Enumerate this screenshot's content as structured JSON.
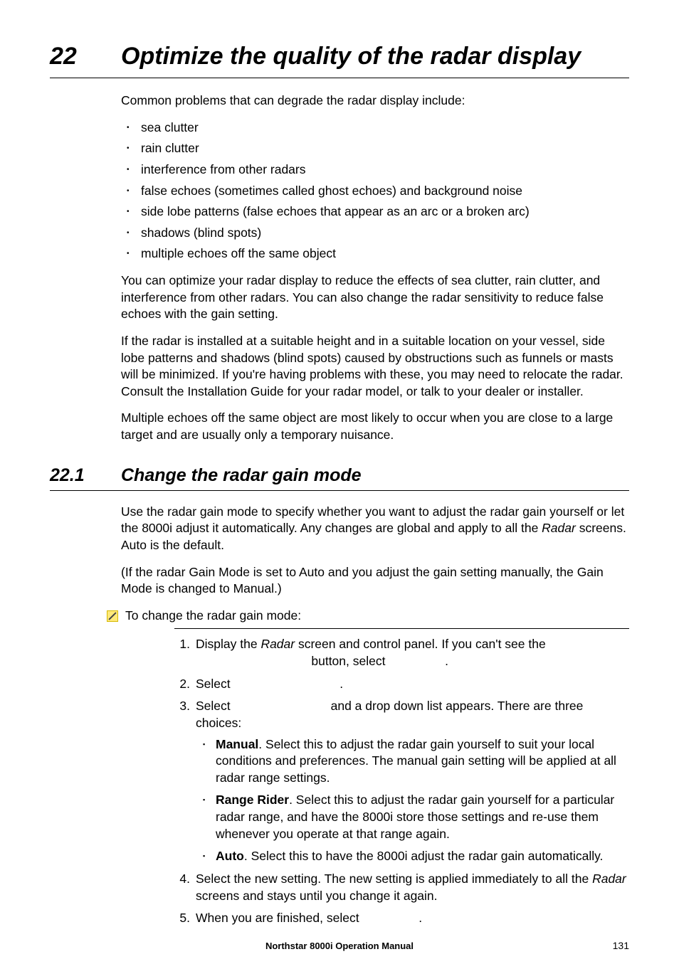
{
  "chapter": {
    "number": "22",
    "title": "Optimize the quality of the radar display"
  },
  "intro_para": "Common problems that can degrade the radar display include:",
  "problems": [
    "sea clutter",
    "rain clutter",
    "interference from other radars",
    "false echoes (sometimes called ghost echoes) and background noise",
    "side lobe patterns (false echoes that appear as an arc or a broken arc)",
    "shadows (blind spots)",
    "multiple echoes off the same object"
  ],
  "para2": "You can optimize your radar display to reduce the effects of sea clutter, rain clutter, and interference from other radars. You can also change the radar sensitivity to reduce false echoes with the gain setting.",
  "para3": "If the radar is installed at a suitable height and in a suitable location on your vessel, side lobe patterns and shadows (blind spots) caused by obstructions such as funnels or masts will be minimized. If you're having problems with these, you may need to relocate the radar. Consult the Installation Guide for your radar model, or talk to your dealer or installer.",
  "para4": "Multiple echoes off the same object are most likely to occur when you are close to a large target and are usually only a temporary nuisance.",
  "section": {
    "number": "22.1",
    "title": "Change the radar gain mode"
  },
  "section_para1_a": "Use the radar gain mode to specify whether you want to adjust the radar gain yourself or let the 8000i adjust it automatically. Any changes are global and apply to all the ",
  "section_para1_italic": "Radar",
  "section_para1_b": " screens. Auto is the default.",
  "section_para2": "(If the radar Gain Mode is set to Auto and you adjust the gain setting manually, the Gain Mode is changed to Manual.)",
  "procedure_label": "To change the radar gain mode:",
  "steps": {
    "s1_a": "Display the ",
    "s1_italic": "Radar",
    "s1_b": " screen and control panel. If you can't see the ",
    "s1_c": " button, select ",
    "s1_d": ".",
    "s2_a": "Select ",
    "s2_b": ".",
    "s3_a": "Select ",
    "s3_b": " and a drop down list appears. There are three choices:",
    "sub1_bold": "Manual",
    "sub1_text": ". Select this to adjust the radar gain yourself to suit your local conditions and preferences. The manual gain setting will be applied at all radar range settings.",
    "sub2_bold": "Range Rider",
    "sub2_text": ". Select this to adjust the radar gain yourself for a particular radar range, and have the 8000i store those settings and re-use them whenever you operate at that range again.",
    "sub3_bold": "Auto",
    "sub3_text": ". Select this to have the 8000i adjust the radar gain automatically.",
    "s4_a": "Select the new setting. The new setting is applied immediately to all the ",
    "s4_italic": "Radar",
    "s4_b": " screens and stays until you change it again.",
    "s5_a": "When you are finished, select ",
    "s5_b": "."
  },
  "footer": {
    "title": "Northstar 8000i Operation Manual",
    "page": "131"
  }
}
